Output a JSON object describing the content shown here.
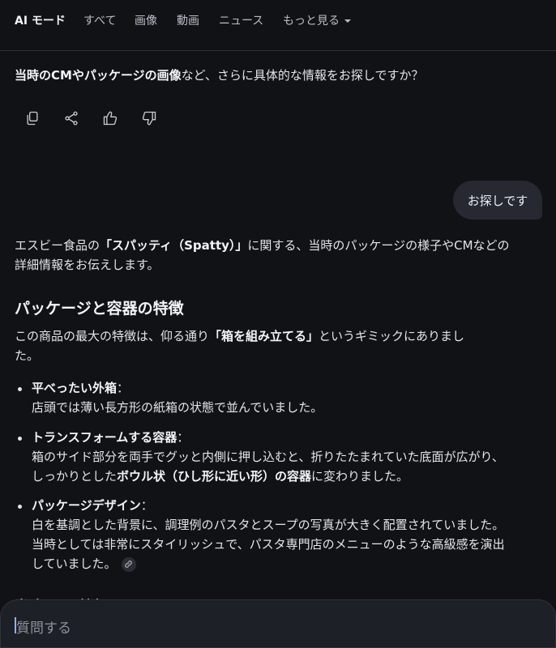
{
  "nav": {
    "tabs": [
      "AI モード",
      "すべて",
      "画像",
      "動画",
      "ニュース"
    ],
    "more_label": "もっと見る"
  },
  "lead": {
    "bold": "当時のCMやパッケージの画像",
    "rest": "など、さらに具体的な情報をお探しですか？"
  },
  "actions": {
    "icons": [
      "copy-icon",
      "share-icon",
      "thumbs-up-icon",
      "thumbs-down-icon"
    ]
  },
  "user_message": "お探しです",
  "answer": {
    "intro_1_a": "エスビー食品の",
    "intro_1_b": "「スパッティ（Spatty）」",
    "intro_1_c": "に関する、当時のパッケージの様子やCMなどの",
    "intro_2": "詳細情報をお伝えします。",
    "heading": "パッケージと容器の特徴",
    "p_1_a": "この商品の最大の特徴は、仰る通り",
    "p_1_b": "「箱を組み立てる」",
    "p_1_c": "というギミックにありまし",
    "p_2": "た。",
    "items": [
      {
        "title": "平べったい外箱",
        "colon": "：",
        "lines": [
          "店頭では薄い長方形の紙箱の状態で並んでいました。"
        ]
      },
      {
        "title": "トランスフォームする容器",
        "colon": "：",
        "line_1": "箱のサイド部分を両手でグッと内側に押し込むと、折りたたまれていた底面が広がり、",
        "line_2_a": "しっかりとした",
        "line_2_b": "ボウル状（ひし形に近い形）の容器",
        "line_2_c": "に変わりました。"
      },
      {
        "title": "パッケージデザイン",
        "colon": "：",
        "lines": [
          "白を基調とした背景に、調理例のパスタとスープの写真が大きく配置されていました。",
          "当時としては非常にスタイリッシュで、パスタ専門店のメニューのような高級感を演出",
          "していました。"
        ]
      }
    ],
    "cut_heading": "当時のCM情報"
  },
  "input": {
    "placeholder": "質問する"
  }
}
